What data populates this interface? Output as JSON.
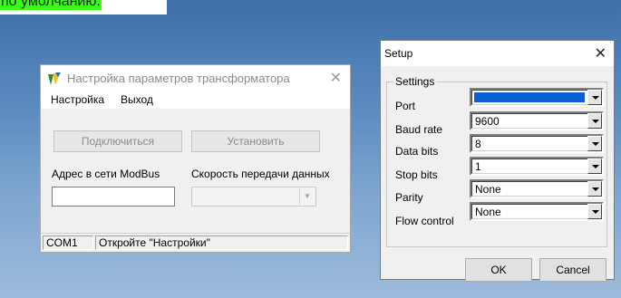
{
  "banner": {
    "text": "по умолчанию."
  },
  "main_window": {
    "title": "Настройка параметров трансформатора",
    "close_glyph": "✕",
    "menu": [
      "Настройка",
      "Выход"
    ],
    "buttons": {
      "connect": "Подключиться",
      "set": "Установить"
    },
    "fields": {
      "modbus_address_label": "Адрес в сети ModBus",
      "modbus_address_value": "",
      "baud_label": "Скорость передачи данных",
      "baud_value": ""
    },
    "status": {
      "port": "COM1",
      "message": "Откройте \"Настройки\""
    }
  },
  "setup_dialog": {
    "title": "Setup",
    "close_glyph": "✕",
    "group_label": "Settings",
    "fields": [
      {
        "label": "Port",
        "value": ""
      },
      {
        "label": "Baud rate",
        "value": "9600"
      },
      {
        "label": "Data bits",
        "value": "8"
      },
      {
        "label": "Stop bits",
        "value": "1"
      },
      {
        "label": "Parity",
        "value": "None"
      },
      {
        "label": "Flow control",
        "value": "None"
      }
    ],
    "buttons": {
      "ok": "OK",
      "cancel": "Cancel"
    }
  },
  "colors": {
    "highlight": "#39ff14",
    "selection": "#0a5fd6",
    "desktop": "#5a8ac0"
  }
}
